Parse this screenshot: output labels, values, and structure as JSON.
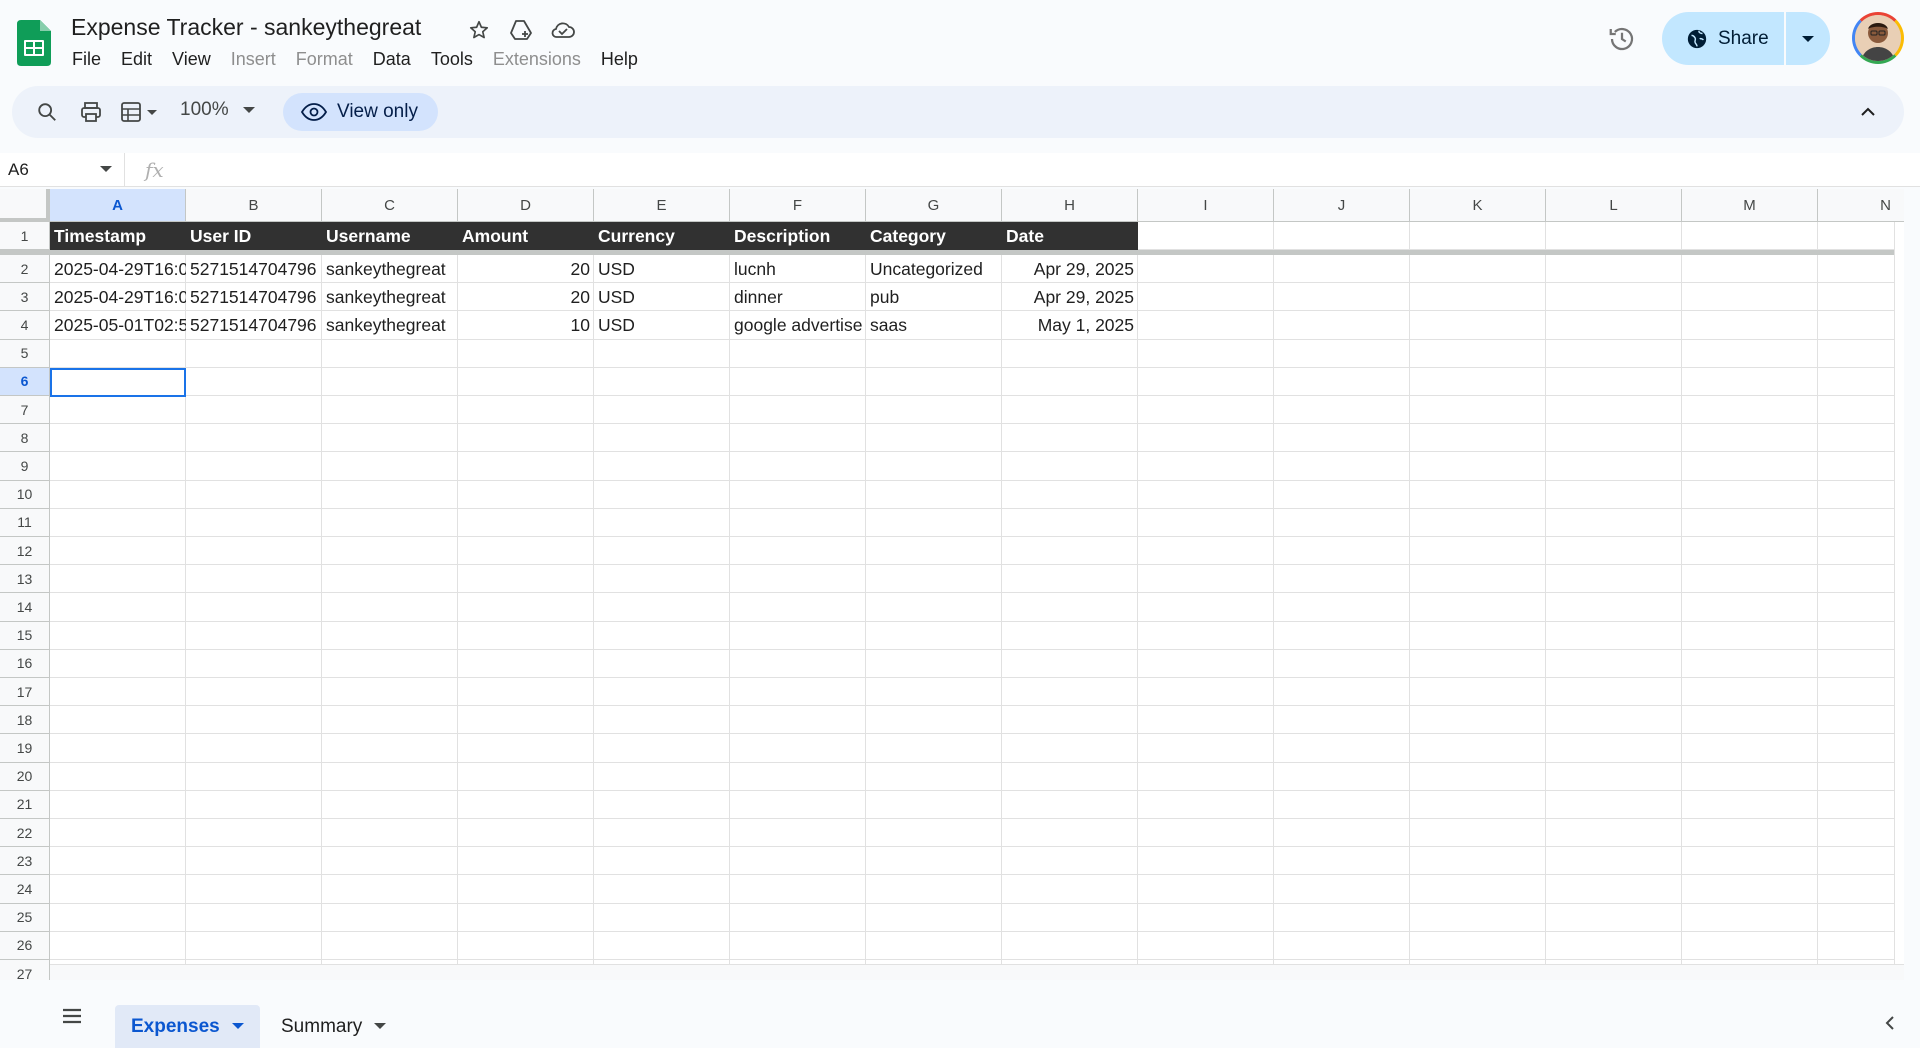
{
  "document": {
    "title": "Expense Tracker - sankeythegreat"
  },
  "menu": {
    "items": [
      {
        "label": "File",
        "enabled": true
      },
      {
        "label": "Edit",
        "enabled": true
      },
      {
        "label": "View",
        "enabled": true
      },
      {
        "label": "Insert",
        "enabled": false
      },
      {
        "label": "Format",
        "enabled": false
      },
      {
        "label": "Data",
        "enabled": true
      },
      {
        "label": "Tools",
        "enabled": true
      },
      {
        "label": "Extensions",
        "enabled": false
      },
      {
        "label": "Help",
        "enabled": true
      }
    ]
  },
  "share": {
    "label": "Share"
  },
  "toolbar": {
    "zoom": "100%",
    "mode_label": "View only"
  },
  "formula_bar": {
    "cell_ref": "A6",
    "fx_label": "fx"
  },
  "sheet": {
    "columns": [
      "A",
      "B",
      "C",
      "D",
      "E",
      "F",
      "G",
      "H",
      "I",
      "J",
      "K",
      "L",
      "M",
      "N"
    ],
    "selected_column": "A",
    "selected_row": 6,
    "row_count": 27,
    "header": [
      "Timestamp",
      "User ID",
      "Username",
      "Amount",
      "Currency",
      "Description",
      "Category",
      "Date"
    ],
    "rows": [
      [
        "2025-04-29T16:0",
        "5271514704796",
        "sankeythegreat",
        "20",
        "USD",
        "lucnh",
        "Uncategorized",
        "Apr 29, 2025"
      ],
      [
        "2025-04-29T16:0",
        "5271514704796",
        "sankeythegreat",
        "20",
        "USD",
        "dinner",
        "pub",
        "Apr 29, 2025"
      ],
      [
        "2025-05-01T02:5",
        "5271514704796",
        "sankeythegreat",
        "10",
        "USD",
        "google advertise",
        "saas",
        "May 1, 2025"
      ]
    ]
  },
  "tabs": [
    {
      "label": "Expenses",
      "active": true
    },
    {
      "label": "Summary",
      "active": false
    }
  ],
  "colors": {
    "accent": "#0b57d0",
    "header_fill": "#313131",
    "share_bg": "#c2e7ff",
    "sheets_green": "#0f9d58"
  }
}
